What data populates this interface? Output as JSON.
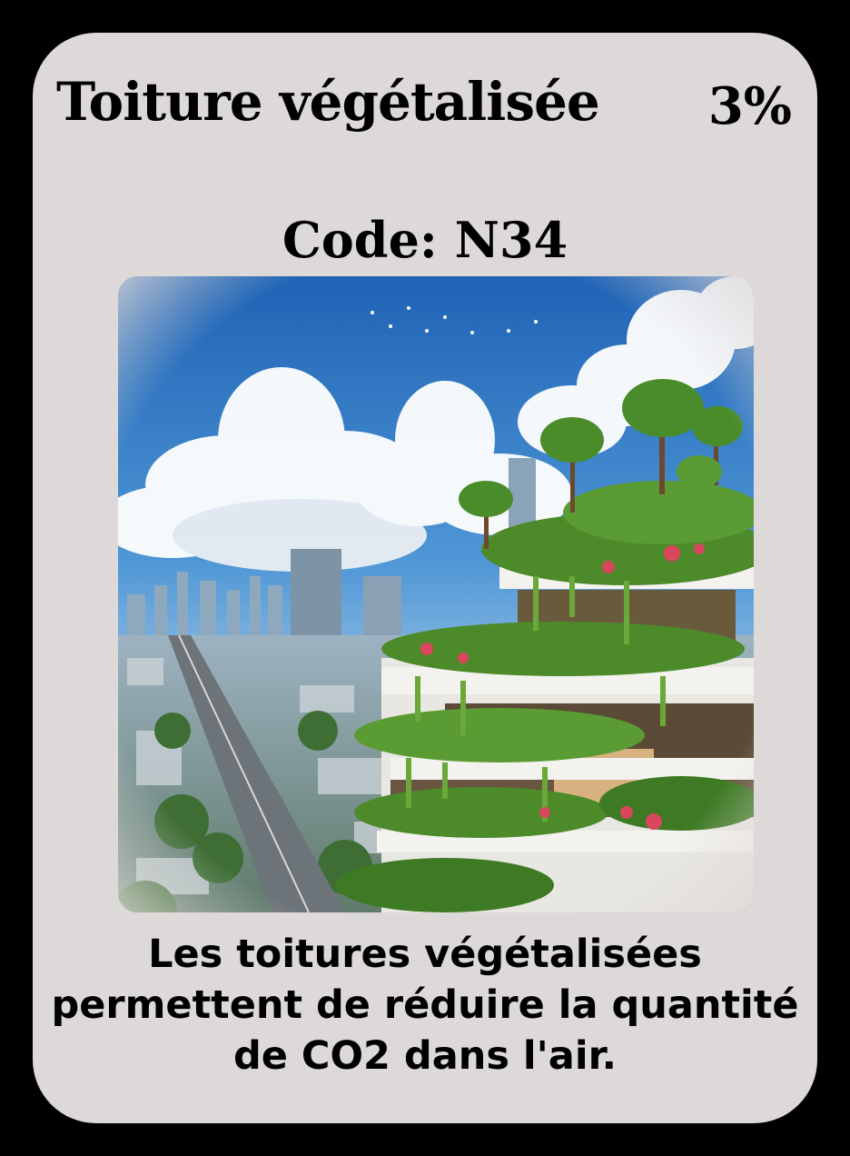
{
  "card": {
    "title": "Toiture végétalisée",
    "percent": "3%",
    "code": "Code: N34",
    "description": "Les toitures végétalisées permettent de réduire la quantité de CO2 dans l'air."
  },
  "colors": {
    "card_background": "#dcd9d8",
    "page_background": "#000000",
    "text": "#000000",
    "sky": "#2f7bc8",
    "foliage": "#4c8a2a"
  }
}
